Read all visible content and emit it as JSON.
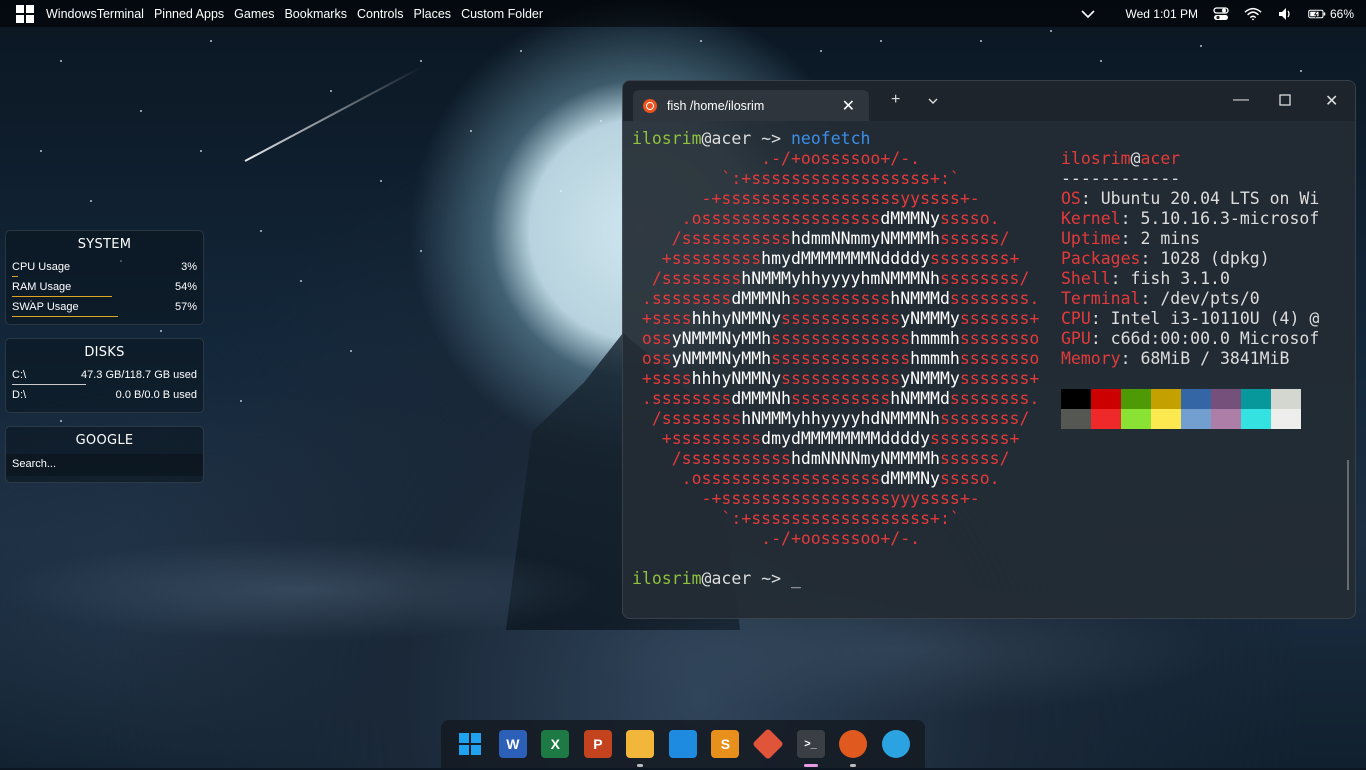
{
  "topbar": {
    "start_icon": "windows-logo-icon",
    "menus": [
      "WindowsTerminal",
      "Pinned Apps",
      "Games",
      "Bookmarks",
      "Controls",
      "Places",
      "Custom Folder"
    ],
    "datetime": "Wed 1:01 PM",
    "battery": "66%",
    "icons": [
      "chevron-down-icon",
      "toggle-icon",
      "wifi-icon",
      "volume-icon",
      "battery-charging-icon"
    ]
  },
  "widgets": {
    "system": {
      "title": "SYSTEM",
      "rows": [
        {
          "label": "CPU Usage",
          "value": "3%",
          "level": 0.03
        },
        {
          "label": "RAM Usage",
          "value": "54%",
          "level": 0.54
        },
        {
          "label": "SWAP Usage",
          "value": "57%",
          "level": 0.57
        }
      ]
    },
    "disks": {
      "title": "DISKS",
      "rows": [
        {
          "label": "C:\\",
          "value": "47.3 GB/118.7 GB used",
          "level": 0.4
        },
        {
          "label": "D:\\",
          "value": "0.0 B/0.0 B used",
          "level": 0.0
        }
      ]
    },
    "google": {
      "title": "GOOGLE",
      "search_placeholder": "Search..."
    }
  },
  "terminal": {
    "tab_title": "fish /home/ilosrim",
    "tab_icon": "ubuntu-icon",
    "new_tab": "+",
    "prompt_user": "ilosrim",
    "prompt_host": "acer",
    "prompt_arrow": " ~> ",
    "command": "neofetch",
    "cursor": "_",
    "logo_lines": [
      "             .-/+oossssoo+/-.",
      "         `:+ssssssssssssssssss+:`",
      "       -+ssssssssssssssssssyyssss+-",
      "     .ossssssssssssssssssdMMMNysssso.",
      "    /ssssssssssshdmmNNmmyNMMMMhssssss/",
      "   +ssssssssshmydMMMMMMMNddddyssssssss+",
      "  /sssssssshNMMMyhhyyyyhmNMMMNhssssssss/",
      " .ssssssssdMMMNhsssssssssshNMMMdssssssss.",
      " +sssshhhyNMMNyssssssssssssyNMMMysssssss+",
      " ossyNMMMNyMMhsssssssssssssshmmmhssssssso",
      " ossyNMMMNyMMhsssssssssssssshmmmhssssssso",
      " +sssshhhyNMMNyssssssssssssyNMMMysssssss+",
      " .ssssssssdMMMNhsssssssssshNMMMdssssssss.",
      "  /sssssssshNMMMyhhyyyyhdNMMMNhssssssss/",
      "   +sssssssssdmydMMMMMMMMddddyssssssss+",
      "    /ssssssssssshdmNNNNmyNMMMMhssssss/",
      "     .ossssssssssssssssssdMMMNysssso.",
      "       -+sssssssssssssssssyyyssss+-",
      "         `:+ssssssssssssssssss+:`",
      "             .-/+oossssoo+/-."
    ],
    "info_user": "ilosrim",
    "info_host": "acer",
    "info_sep": "------------",
    "info": [
      {
        "key": "OS",
        "value": ": Ubuntu 20.04 LTS on Wi"
      },
      {
        "key": "Kernel",
        "value": ": 5.10.16.3-microsof"
      },
      {
        "key": "Uptime",
        "value": ": 2 mins"
      },
      {
        "key": "Packages",
        "value": ": 1028 (dpkg)"
      },
      {
        "key": "Shell",
        "value": ": fish 3.1.0"
      },
      {
        "key": "Terminal",
        "value": ": /dev/pts/0"
      },
      {
        "key": "CPU",
        "value": ": Intel i3-10110U (4) @"
      },
      {
        "key": "GPU",
        "value": ": c66d:00:00.0 Microsof"
      },
      {
        "key": "Memory",
        "value": ": 68MiB / 3841MiB"
      }
    ],
    "palette_top": [
      "#000000",
      "#cd0000",
      "#4e9a06",
      "#c4a000",
      "#3465a4",
      "#75507b",
      "#06989a",
      "#d3d7cf"
    ],
    "palette_bottom": [
      "#555753",
      "#ef2929",
      "#8ae234",
      "#fce94f",
      "#729fcf",
      "#ad7fa8",
      "#34e2e2",
      "#eeeeec"
    ]
  },
  "taskbar": {
    "apps": [
      {
        "name": "start-icon",
        "glyph": "",
        "color": "#1fa3f0"
      },
      {
        "name": "word-icon",
        "glyph": "W",
        "color": "#2b5fb8"
      },
      {
        "name": "excel-icon",
        "glyph": "X",
        "color": "#1d7a45"
      },
      {
        "name": "powerpoint-icon",
        "glyph": "P",
        "color": "#c4431f"
      },
      {
        "name": "file-explorer-icon",
        "glyph": "",
        "color": "#f2b63a"
      },
      {
        "name": "vscode-icon",
        "glyph": "",
        "color": "#1e8ae0"
      },
      {
        "name": "sublime-text-icon",
        "glyph": "S",
        "color": "#e8901b"
      },
      {
        "name": "git-icon",
        "glyph": "",
        "color": "#e0553a"
      },
      {
        "name": "terminal-icon",
        "glyph": ">_",
        "color": "#3a3f45"
      },
      {
        "name": "firefox-icon",
        "glyph": "",
        "color": "#e05a20"
      },
      {
        "name": "telegram-icon",
        "glyph": "",
        "color": "#2aa3e0"
      }
    ]
  }
}
